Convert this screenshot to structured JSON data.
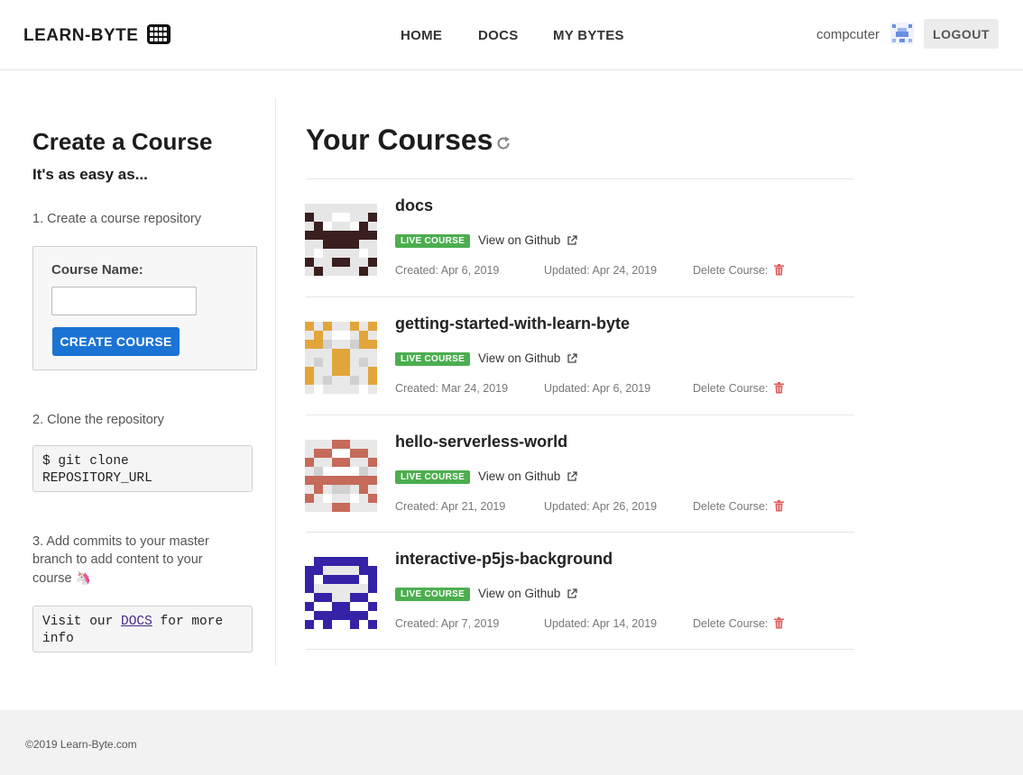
{
  "header": {
    "brand": "LEARN-BYTE",
    "nav": [
      "HOME",
      "DOCS",
      "MY BYTES"
    ],
    "username": "compcuter",
    "logout_label": "LOGOUT"
  },
  "sidebar": {
    "title": "Create a Course",
    "subtitle": "It's as easy as...",
    "step1": "1. Create a course repository",
    "course_name_label": "Course Name:",
    "course_name_value": "",
    "create_button": "CREATE COURSE",
    "step2": "2. Clone the repository",
    "clone_command_line1": "$ git clone",
    "clone_command_line2": "REPOSITORY_URL",
    "step3_line1": "3. Add commits to your master",
    "step3_line2": "branch to add content to your",
    "step3_line3": "course",
    "step3_emoji": "🦄",
    "docs_note_prefix": "Visit our",
    "docs_note_link": "DOCS",
    "docs_note_suffix_line1": "for more",
    "docs_note_suffix_line2": "info"
  },
  "main": {
    "title": "Your Courses",
    "refresh_icon": "refresh-icon",
    "courses": [
      {
        "name": "docs",
        "badge": "LIVE COURSE",
        "github_label": "View on Github",
        "created": "Created: Apr 6, 2019",
        "updated": "Updated: Apr 24, 2019",
        "delete_label": "Delete Course:",
        "avatar_color": "#3a1f1f"
      },
      {
        "name": "getting-started-with-learn-byte",
        "badge": "LIVE COURSE",
        "github_label": "View on Github",
        "created": "Created: Mar 24, 2019",
        "updated": "Updated: Apr 6, 2019",
        "delete_label": "Delete Course:",
        "avatar_color": "#e2a53a"
      },
      {
        "name": "hello-serverless-world",
        "badge": "LIVE COURSE",
        "github_label": "View on Github",
        "created": "Created: Apr 21, 2019",
        "updated": "Updated: Apr 26, 2019",
        "delete_label": "Delete Course:",
        "avatar_color": "#c66a5a"
      },
      {
        "name": "interactive-p5js-background",
        "badge": "LIVE COURSE",
        "github_label": "View on Github",
        "created": "Created: Apr 7, 2019",
        "updated": "Updated: Apr 14, 2019",
        "delete_label": "Delete Course:",
        "avatar_color": "#3423a6"
      }
    ]
  },
  "footer": {
    "copyright": "©2019 Learn-Byte.com"
  },
  "colors": {
    "primary_button": "#1b73d4",
    "live_badge": "#4cae4f",
    "trash": "#e05a5a",
    "user_avatar": "#6a8fe0"
  }
}
